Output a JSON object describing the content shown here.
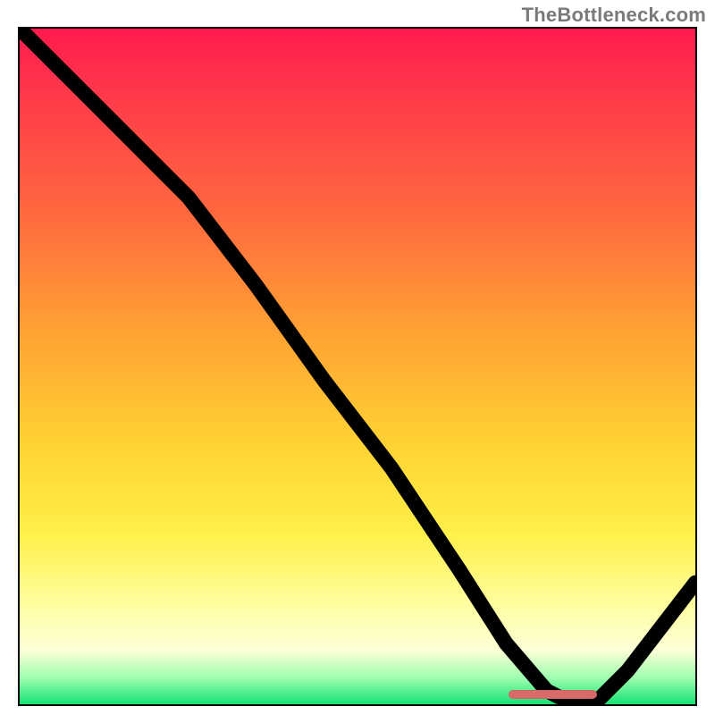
{
  "watermark": "TheBottleneck.com",
  "colors": {
    "gradient_top": "#ff1a4d",
    "gradient_mid1": "#ffa233",
    "gradient_mid2": "#fff04a",
    "gradient_bottom": "#18e072",
    "curve": "#000000",
    "marker": "#d86a6a",
    "frame": "#000000"
  },
  "chart_data": {
    "type": "line",
    "title": "",
    "xlabel": "",
    "ylabel": "",
    "xlim": [
      0,
      100
    ],
    "ylim": [
      0,
      100
    ],
    "grid": false,
    "legend": null,
    "series": [
      {
        "name": "curve",
        "x": [
          0,
          10,
          20,
          25,
          35,
          45,
          55,
          65,
          72,
          78,
          82,
          85,
          90,
          100
        ],
        "y": [
          100,
          90,
          80,
          75,
          62,
          48,
          35,
          20,
          9,
          2,
          0,
          0,
          5,
          18
        ]
      }
    ],
    "annotations": [
      {
        "name": "optimal-band",
        "shape": "pill",
        "x_start": 72,
        "x_end": 85,
        "y": 0
      }
    ]
  }
}
